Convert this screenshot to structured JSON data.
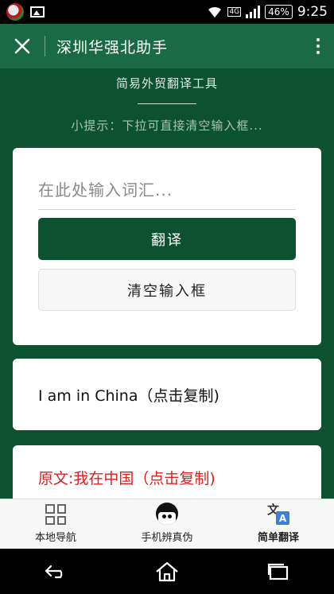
{
  "status_bar": {
    "battery": "46%",
    "network": "4G",
    "time": "9:25"
  },
  "appbar": {
    "title": "深圳华强北助手"
  },
  "page": {
    "subtitle": "简易外贸翻译工具",
    "hint": "小提示：下拉可直接清空输入框..."
  },
  "translator": {
    "input_placeholder": "在此处输入词汇...",
    "input_value": "",
    "translate_label": "翻译",
    "clear_label": "清空输入框"
  },
  "results": {
    "translation": "I am in China（点击复制)",
    "original": "原文:我在中国（点击复制)"
  },
  "bottom_nav": [
    {
      "label": "本地导航",
      "icon": "grid-icon",
      "active": false
    },
    {
      "label": "手机辨真伪",
      "icon": "face-icon",
      "active": false
    },
    {
      "label": "简单翻译",
      "icon": "translate-icon",
      "active": true
    }
  ],
  "trans_icon": {
    "glyph": "文",
    "letter": "A"
  },
  "colors": {
    "primary": "#0d5230",
    "appbar": "#1a6b45",
    "accent_red": "#e02020",
    "translate_blue": "#3a7fd8"
  }
}
